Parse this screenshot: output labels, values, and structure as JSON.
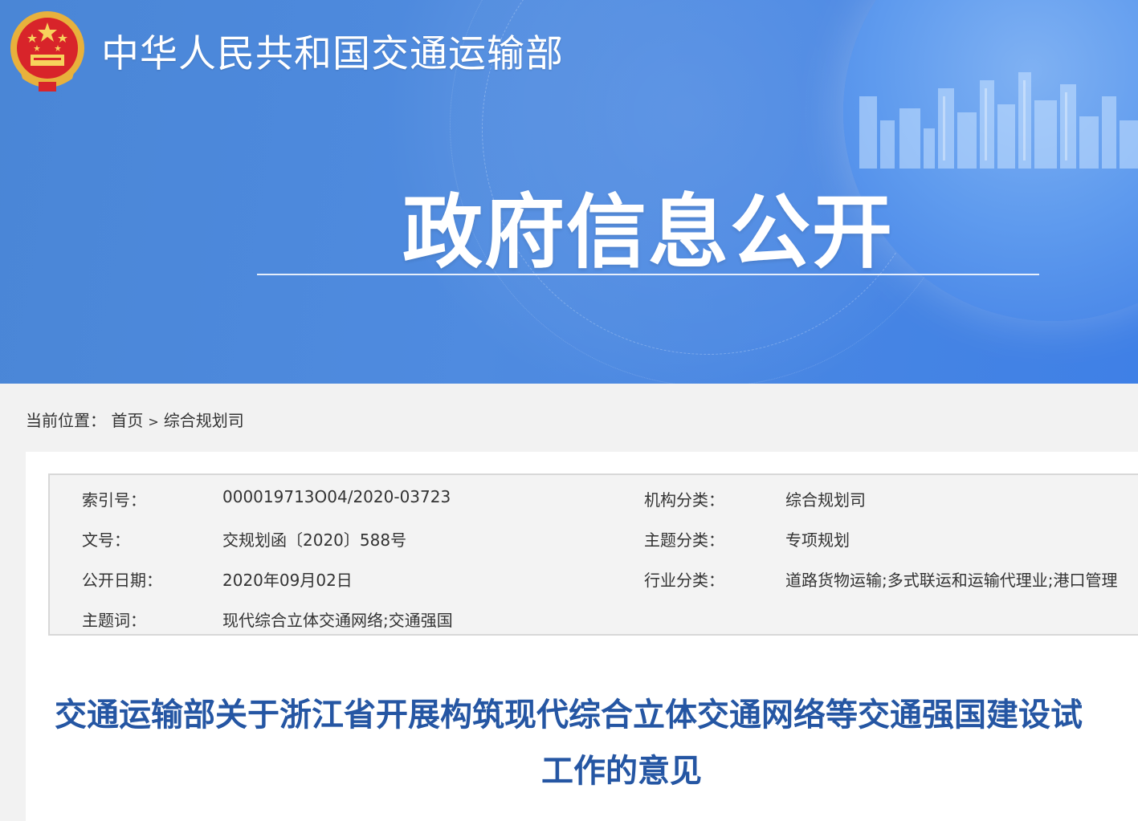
{
  "header": {
    "org_name": "中华人民共和国交通运输部",
    "section_title": "政府信息公开"
  },
  "breadcrumb": {
    "label": "当前位置：",
    "items": [
      "首页",
      "综合规划司"
    ],
    "separator": ">"
  },
  "metadata": {
    "index_no_label": "索引号：",
    "index_no": "000019713O04/2020-03723",
    "org_label": "机构分类：",
    "org": "综合规划司",
    "doc_no_label": "文号：",
    "doc_no": "交规划函〔2020〕588号",
    "topic_label": "主题分类：",
    "topic": "专项规划",
    "date_label": "公开日期：",
    "date": "2020年09月02日",
    "industry_label": "行业分类：",
    "industry": "道路货物运输;多式联运和运输代理业;港口管理",
    "keywords_label": "主题词：",
    "keywords": "现代综合立体交通网络;交通强国"
  },
  "article": {
    "title_line1": "交通运输部关于浙江省开展构筑现代综合立体交通网络等交通强国建设试",
    "title_line2": "工作的意见"
  },
  "colors": {
    "banner_blue": "#4a86d6",
    "title_blue": "#2556a3",
    "page_bg": "#f2f2f2"
  }
}
